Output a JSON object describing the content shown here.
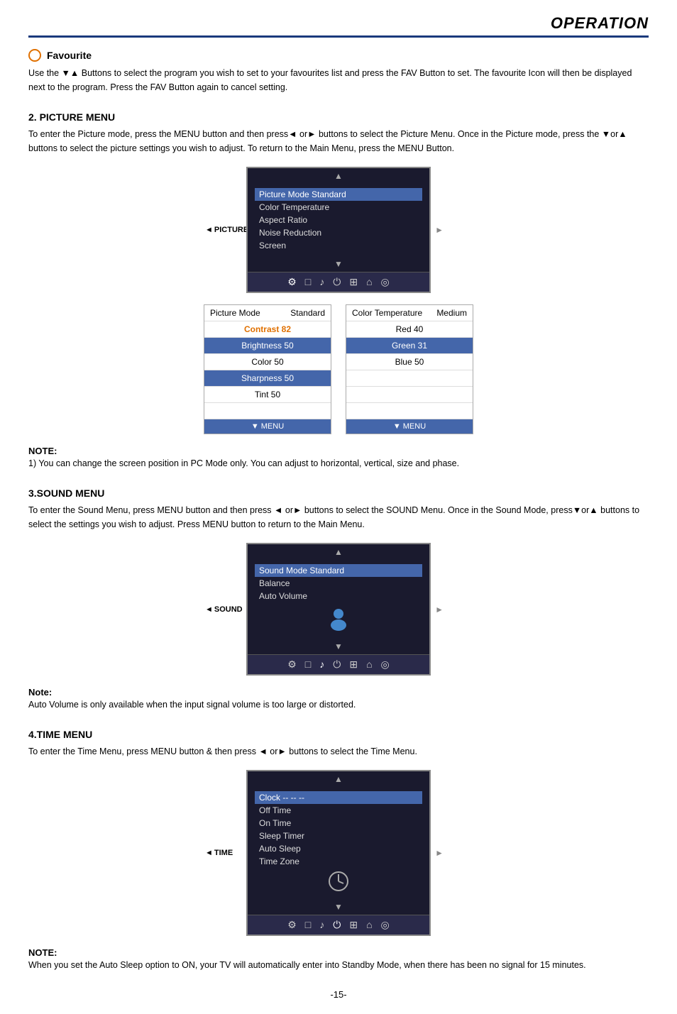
{
  "header": {
    "title": "OPERATION"
  },
  "favourite": {
    "title": "Favourite",
    "body": "Use the ▼▲  Buttons to select the program you wish to set to your favourites list and press the FAV Button to set. The favourite Icon will then be displayed next to the program.  Press the FAV Button again to cancel setting."
  },
  "picture_menu": {
    "title": "2. PICTURE MENU",
    "body": "To enter the Picture mode, press the MENU button and then press◄ or► buttons to select the Picture Menu. Once in the Picture mode, press the ▼or▲ buttons to select the picture settings you wish to adjust. To return to the Main Menu, press the MENU Button.",
    "tv_menu": {
      "items": [
        "Picture Mode Standard",
        "Color Temperature",
        "Aspect Ratio",
        "Noise Reduction",
        "Screen"
      ],
      "selected_index": 0,
      "left_label": "◄ PICTURE",
      "right_label": "►",
      "icons": [
        "⚙",
        "□",
        "♪",
        "⏻",
        "⊞",
        "⌂",
        "◎"
      ]
    },
    "left_table": {
      "header_left": "Picture Mode",
      "header_right": "Standard",
      "rows": [
        {
          "label": "Contrast 82",
          "style": "orange"
        },
        {
          "label": "Brightness 50",
          "style": "highlight"
        },
        {
          "label": "Color 50",
          "style": "normal"
        },
        {
          "label": "Sharpness 50",
          "style": "highlight"
        },
        {
          "label": "Tint 50",
          "style": "normal"
        },
        {
          "label": "",
          "style": "empty"
        },
        {
          "label": "▼ MENU",
          "style": "menu"
        }
      ]
    },
    "right_table": {
      "header_left": "Color Temperature",
      "header_right": "Medium",
      "rows": [
        {
          "label": "Red 40",
          "style": "normal"
        },
        {
          "label": "Green 31",
          "style": "highlight"
        },
        {
          "label": "Blue 50",
          "style": "normal"
        },
        {
          "label": "",
          "style": "empty"
        },
        {
          "label": "",
          "style": "empty"
        },
        {
          "label": "",
          "style": "empty"
        },
        {
          "label": "▼ MENU",
          "style": "menu"
        }
      ]
    },
    "note_title": "NOTE:",
    "note_body": "1) You can change the screen position in PC Mode only. You can adjust to horizontal, vertical, size and phase."
  },
  "sound_menu": {
    "title": "3.SOUND MENU",
    "body": "To enter the Sound Menu, press MENU button and then press ◄ or► buttons to select the SOUND Menu. Once in the Sound Mode,  press▼or▲ buttons to select the settings you wish to adjust.  Press MENU button to return to the Main Menu.",
    "tv_menu": {
      "items": [
        "Sound Mode Standard",
        "Balance",
        "Auto Volume"
      ],
      "left_label": "◄ SOUND",
      "right_label": "►",
      "icons": [
        "⚙",
        "□",
        "♪",
        "⏻",
        "⊞",
        "⌂",
        "◎"
      ]
    },
    "note_title": "Note:",
    "note_body": "Auto Volume is only available when the  input signal volume is too large  or distorted."
  },
  "time_menu": {
    "title": "4.TIME MENU",
    "body": "To enter the Time Menu, press MENU button &  then press ◄  or► buttons to select the Time Menu.",
    "tv_menu": {
      "items": [
        "Clock  --   --   --",
        "Off Time",
        "On Time",
        "Sleep Timer",
        "Auto Sleep",
        "Time Zone"
      ],
      "left_label": "◄ TIME",
      "right_label": "►",
      "icons": [
        "⚙",
        "□",
        "♪",
        "⏻",
        "⊞",
        "⌂",
        "◎"
      ]
    },
    "note_title": "NOTE:",
    "note_body": "When you set the Auto Sleep option to ON, your TV will automatically enter into Standby Mode, when there has been no signal for 15 minutes."
  },
  "page_number": "-15-"
}
